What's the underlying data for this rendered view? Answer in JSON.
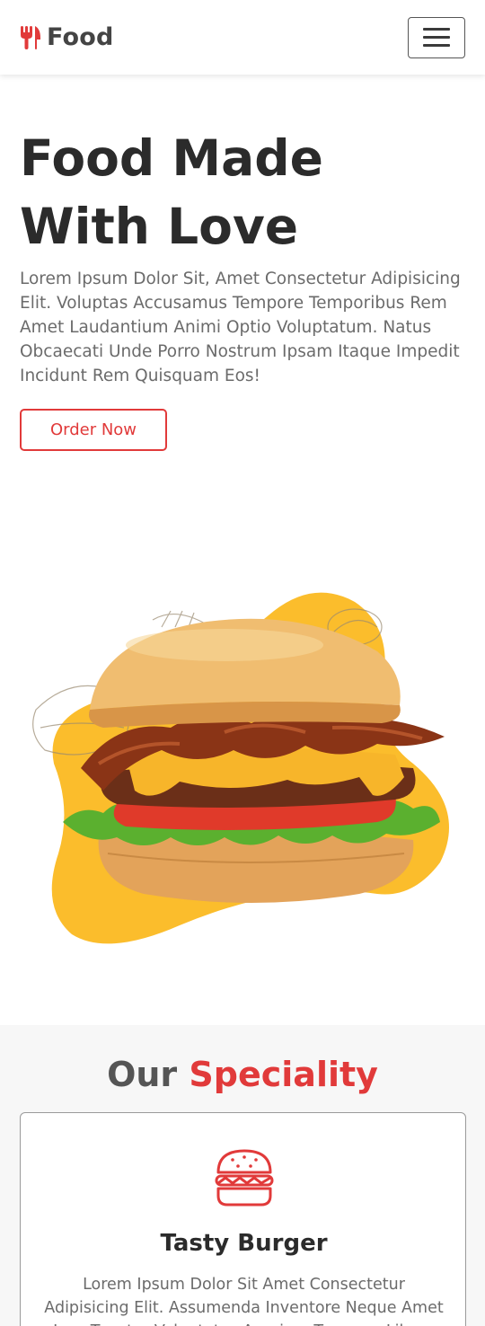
{
  "navbar": {
    "brand": "Food",
    "brand_icon": "utensils-icon",
    "menu_icon": "hamburger-menu-icon"
  },
  "hero": {
    "title": "Food Made With Love",
    "text": "Lorem Ipsum Dolor Sit, Amet Consectetur Adipisicing Elit. Voluptas Accusamus Tempore Temporibus Rem Amet Laudantium Animi Optio Voluptatum. Natus Obcaecati Unde Porro Nostrum Ipsam Itaque Impedit Incidunt Rem Quisquam Eos!",
    "order_button": "Order Now",
    "image": "burger-image"
  },
  "speciality": {
    "title_part1": "Our",
    "title_part2": "Speciality",
    "card": {
      "icon": "burger-icon",
      "title": "Tasty Burger",
      "text": "Lorem Ipsum Dolor Sit Amet Consectetur Adipisicing Elit. Assumenda Inventore Neque Amet Ipsa Tenetur Voluptates Aperiam Tempore Libero Labore Aut."
    }
  },
  "colors": {
    "accent": "#e13a3a",
    "blob": "#fbbd2c",
    "text_dark": "#2b2b2b",
    "text_muted": "#6b6b6b"
  }
}
